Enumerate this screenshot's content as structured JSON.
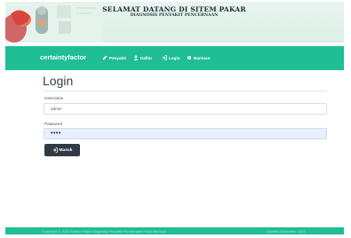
{
  "header": {
    "title": "SELAMAT DATANG DI SITEM PAKAR",
    "subtitle": "DIAGNOSIS PENYAKIT PENCERNAAN"
  },
  "navbar": {
    "brand": "certaintyfactor",
    "items": [
      {
        "label": "Penyakit",
        "icon": "pencil-icon"
      },
      {
        "label": "Daftar",
        "icon": "user-icon"
      },
      {
        "label": "Login",
        "icon": "login-icon"
      },
      {
        "label": "Bantuan",
        "icon": "gear-icon"
      }
    ]
  },
  "main": {
    "title": "Login",
    "username_label": "Username",
    "username_value": "admin",
    "password_label": "Password",
    "password_value": "••••",
    "submit_label": "Masuk"
  },
  "footer": {
    "copyright": "Copyright © 2024 Sistem Pakar Diagnosa Penyakit Pencernaan Pada Manusia",
    "updated": "Updated Desember 2024"
  },
  "colors": {
    "navbar": "#1fbe95",
    "button": "#2f3a45",
    "banner": "#e3f2eb",
    "password_bg": "#e8eefb"
  }
}
